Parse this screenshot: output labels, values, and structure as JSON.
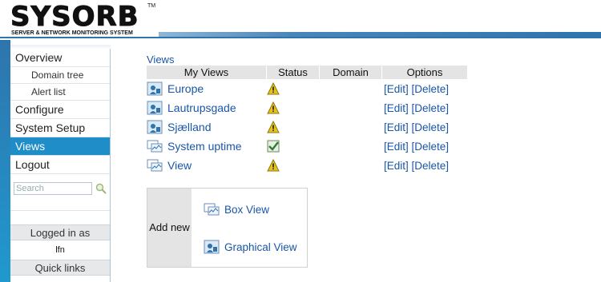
{
  "brand": {
    "logo_text": "SYSORB",
    "trademark": "TM",
    "tagline": "SERVER & NETWORK MONITORING SYSTEM"
  },
  "sidebar": {
    "items": [
      {
        "label": "Overview"
      },
      {
        "label": "Domain tree"
      },
      {
        "label": "Alert list"
      },
      {
        "label": "Configure"
      },
      {
        "label": "System Setup"
      },
      {
        "label": "Views"
      },
      {
        "label": "Logout"
      }
    ],
    "search_placeholder": "Search",
    "logged_in_header": "Logged in as",
    "logged_in_user": "lfn",
    "quick_links_header": "Quick links"
  },
  "main": {
    "section_link": "Views",
    "table": {
      "headers": [
        "My Views",
        "Status",
        "Domain",
        "Options"
      ],
      "rows": [
        {
          "name": "Europe",
          "icon": "graphical-view-icon",
          "status": "warning-icon",
          "domain": "",
          "edit": "[Edit]",
          "delete": "[Delete]"
        },
        {
          "name": "Lautrupsgade",
          "icon": "graphical-view-icon",
          "status": "warning-icon",
          "domain": "",
          "edit": "[Edit]",
          "delete": "[Delete]"
        },
        {
          "name": "Sjælland",
          "icon": "graphical-view-icon",
          "status": "warning-icon",
          "domain": "",
          "edit": "[Edit]",
          "delete": "[Delete]"
        },
        {
          "name": "System uptime",
          "icon": "box-view-icon",
          "status": "ok-check-icon",
          "domain": "",
          "edit": "[Edit]",
          "delete": "[Delete]"
        },
        {
          "name": "View",
          "icon": "box-view-icon",
          "status": "warning-icon",
          "domain": "",
          "edit": "[Edit]",
          "delete": "[Delete]"
        }
      ]
    },
    "add_new": {
      "label": "Add new",
      "box_view": "Box View",
      "graphical_view": "Graphical View"
    }
  },
  "colors": {
    "link": "#1a56a7",
    "accent": "#1f8dc7",
    "header_bar": "#2f74ad",
    "table_header_bg": "#e4e4e4",
    "warning": "#e8c21a"
  }
}
